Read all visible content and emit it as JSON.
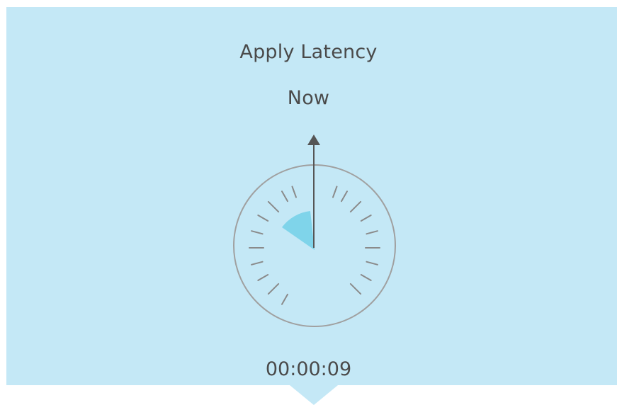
{
  "panel": {
    "title": "Apply Latency",
    "subtitle": "Now",
    "elapsed": "00:00:09",
    "background_color": "#c4e8f6"
  },
  "gauge": {
    "needle_direction": "up",
    "indicator_sector_color": "#7fd4ea",
    "icons": [
      "dial-gauge-icon",
      "needle-arrow-icon"
    ]
  }
}
